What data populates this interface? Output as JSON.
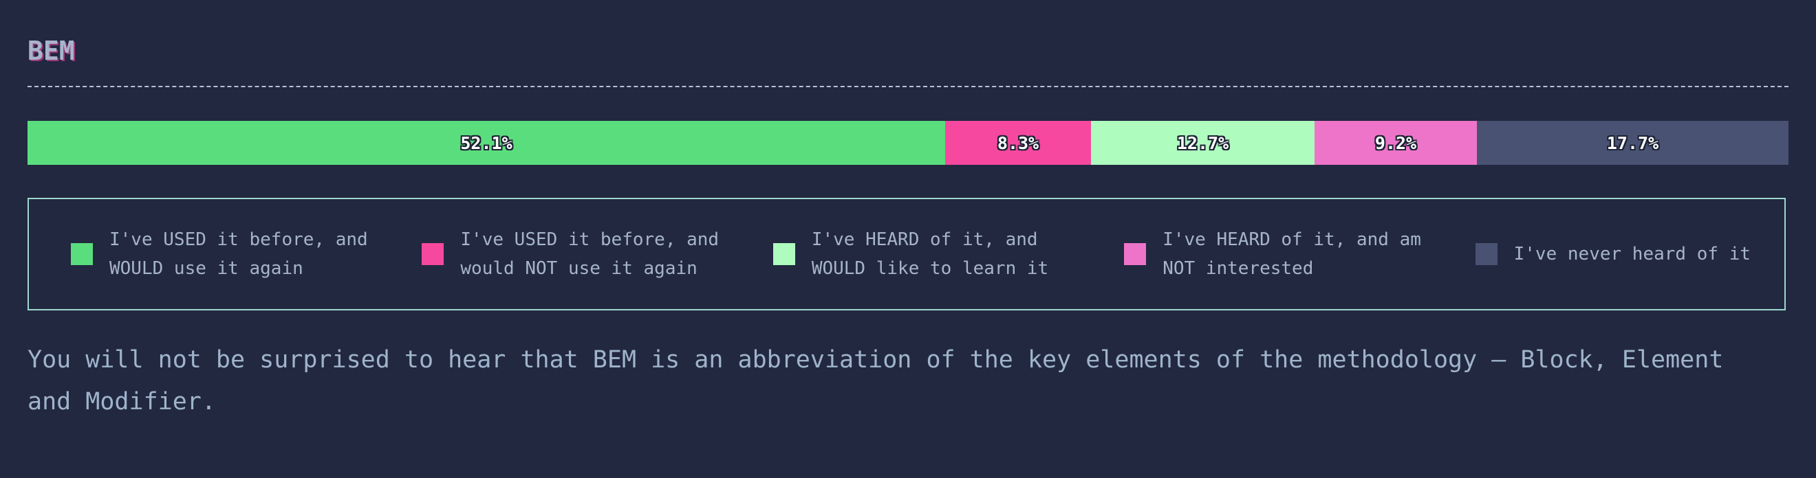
{
  "title": "BEM",
  "chart_data": {
    "type": "bar",
    "stacked": true,
    "orientation": "horizontal",
    "series": [
      {
        "name": "I've USED it before, and WOULD use it again",
        "value": 52.1,
        "label": "52.1%",
        "color": "#5ade7d"
      },
      {
        "name": "I've USED it before, and would NOT use it again",
        "value": 8.3,
        "label": "8.3%",
        "color": "#f5489e"
      },
      {
        "name": "I've HEARD of it, and WOULD like to learn it",
        "value": 12.7,
        "label": "12.7%",
        "color": "#aefdbf"
      },
      {
        "name": "I've HEARD of it, and am NOT interested",
        "value": 9.2,
        "label": "9.2%",
        "color": "#ee74c9"
      },
      {
        "name": "I've never heard of it",
        "value": 17.7,
        "label": "17.7%",
        "color": "#4a5273"
      }
    ],
    "legend": [
      "I've USED it before, and\nWOULD use it again",
      "I've USED it before, and\nwould NOT use it again",
      "I've HEARD of it, and\nWOULD like to learn it",
      "I've HEARD of it, and am\nNOT interested",
      "I've never heard of it"
    ]
  },
  "description": "You will not be surprised to hear that BEM is an abbreviation of the key elements of the methodology — Block, Element and Modifier."
}
